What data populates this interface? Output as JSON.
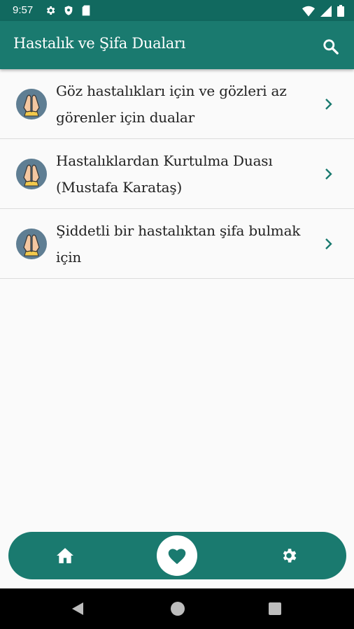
{
  "status": {
    "time": "9:57",
    "icons": [
      "gear-icon",
      "shield-icon",
      "sd-card-icon",
      "wifi-icon",
      "signal-icon",
      "battery-icon"
    ]
  },
  "appbar": {
    "title": "Hastalık ve Şifa Duaları",
    "search_icon": "search-icon"
  },
  "items": [
    {
      "label": "Göz hastalıkları için ve gözleri az görenler için dualar",
      "icon": "praying-hands-icon"
    },
    {
      "label": "Hastalıklardan Kurtulma Duası (Mustafa Karataş)",
      "icon": "praying-hands-icon"
    },
    {
      "label": "Şiddetli bir hastalıktan şifa bulmak için",
      "icon": "praying-hands-icon"
    }
  ],
  "bottom_nav": {
    "items": [
      "home-icon",
      "heart-icon",
      "gear-icon"
    ],
    "active": "heart-icon"
  },
  "colors": {
    "primary": "#1a7a6f",
    "status_bar": "#11695f",
    "chevron": "#1a7a6f"
  }
}
